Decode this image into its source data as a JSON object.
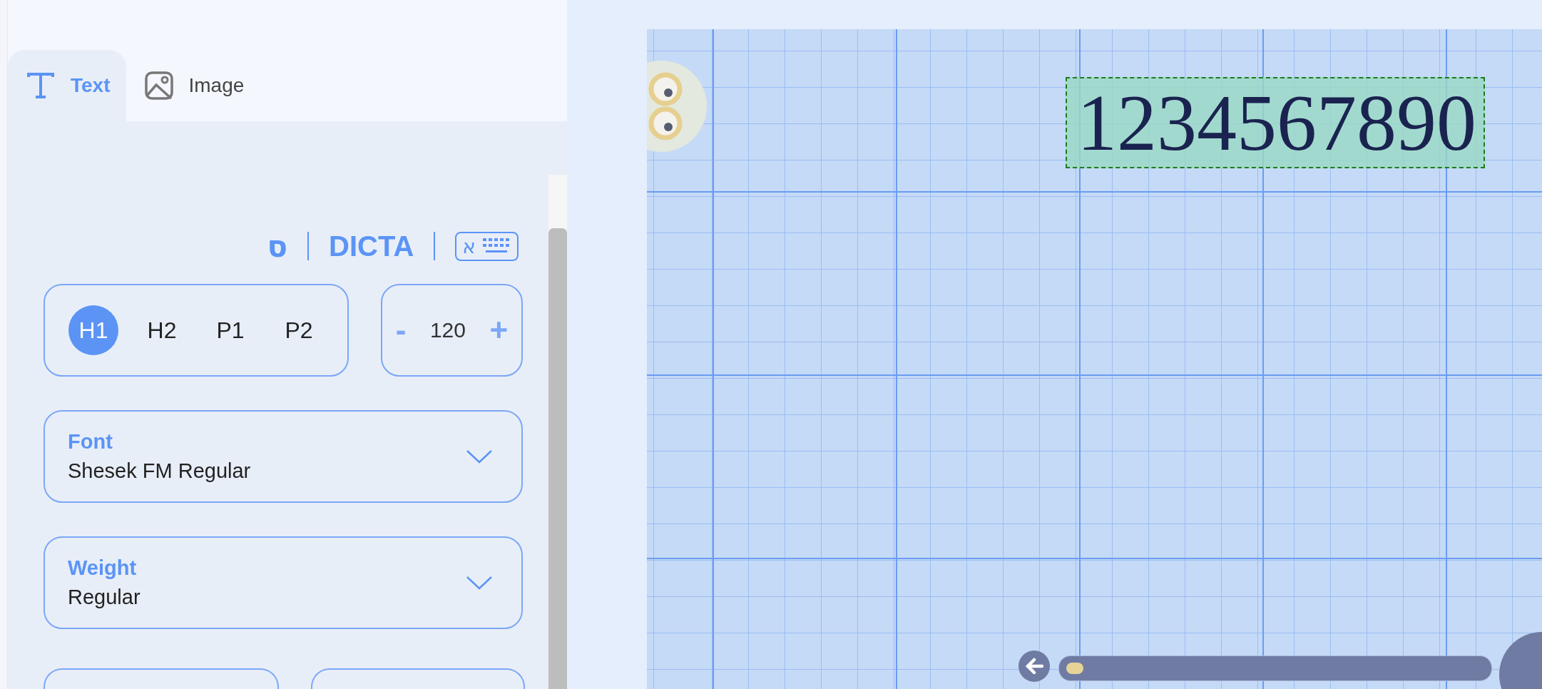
{
  "tabs": [
    {
      "label": "Text",
      "kind": "text",
      "selected": true
    },
    {
      "label": "Image",
      "kind": "image",
      "selected": false
    }
  ],
  "toolbar": {
    "vowel_mark": "ס",
    "engine": "DICTA",
    "keyboard_letter": "א"
  },
  "styles": [
    {
      "label": "H1",
      "selected": true
    },
    {
      "label": "H2",
      "selected": false
    },
    {
      "label": "P1",
      "selected": false
    },
    {
      "label": "P2",
      "selected": false
    }
  ],
  "size": {
    "minus": "-",
    "value": "120",
    "plus": "+"
  },
  "fields": [
    {
      "label": "Font",
      "value": "Shesek FM Regular"
    },
    {
      "label": "Weight",
      "value": "Regular"
    }
  ],
  "canvas": {
    "text": "1234567890"
  },
  "timeline": {
    "level": 0
  }
}
